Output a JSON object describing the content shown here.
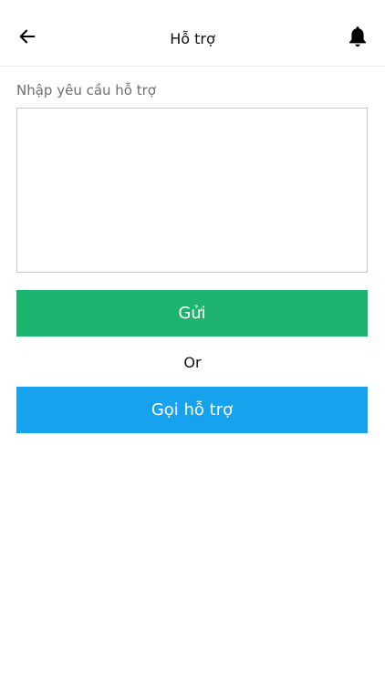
{
  "header": {
    "title": "Hỗ trợ",
    "back_icon": "arrow-left-icon",
    "notification_icon": "bell-icon"
  },
  "form": {
    "label": "Nhập yêu cầu hỗ trợ",
    "value": "",
    "send_label": "Gửi"
  },
  "divider_text": "Or",
  "call_label": "Gọi hỗ trợ",
  "colors": {
    "send_button": "#1db46f",
    "call_button": "#16a2ec"
  }
}
